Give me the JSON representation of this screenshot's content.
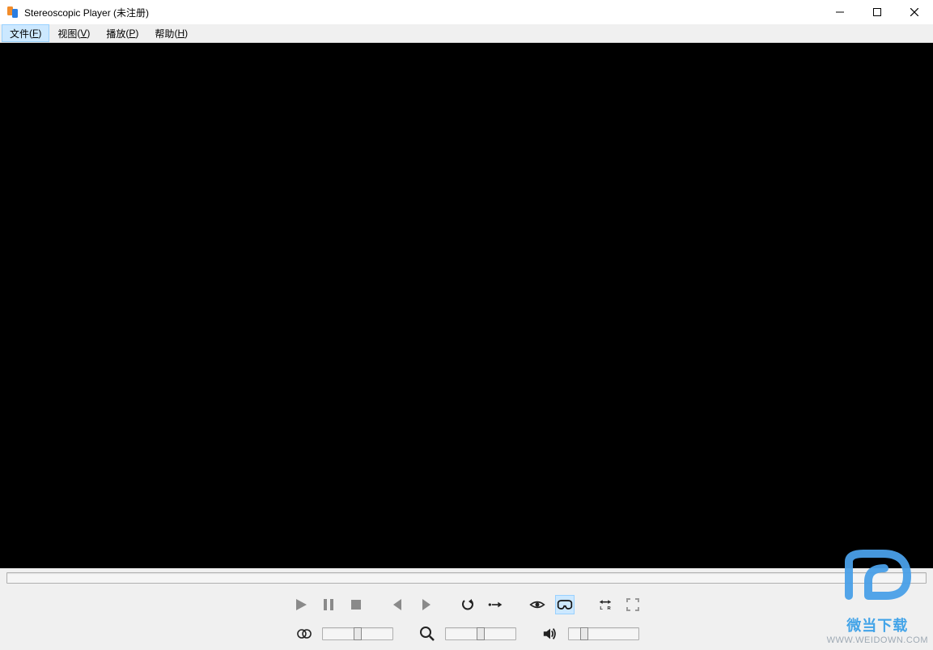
{
  "titlebar": {
    "title": "Stereoscopic Player (未注册)"
  },
  "menu": {
    "file": {
      "label": "文件",
      "hotkey": "F"
    },
    "view": {
      "label": "视图",
      "hotkey": "V"
    },
    "play": {
      "label": "播放",
      "hotkey": "P"
    },
    "help": {
      "label": "帮助",
      "hotkey": "H"
    }
  },
  "controls": {
    "sep_thumb_percent": 50,
    "zoom_thumb_percent": 50,
    "volume_thumb_percent": 18
  },
  "watermark": {
    "text": "微当下载",
    "url": "WWW.WEIDOWN.COM"
  }
}
